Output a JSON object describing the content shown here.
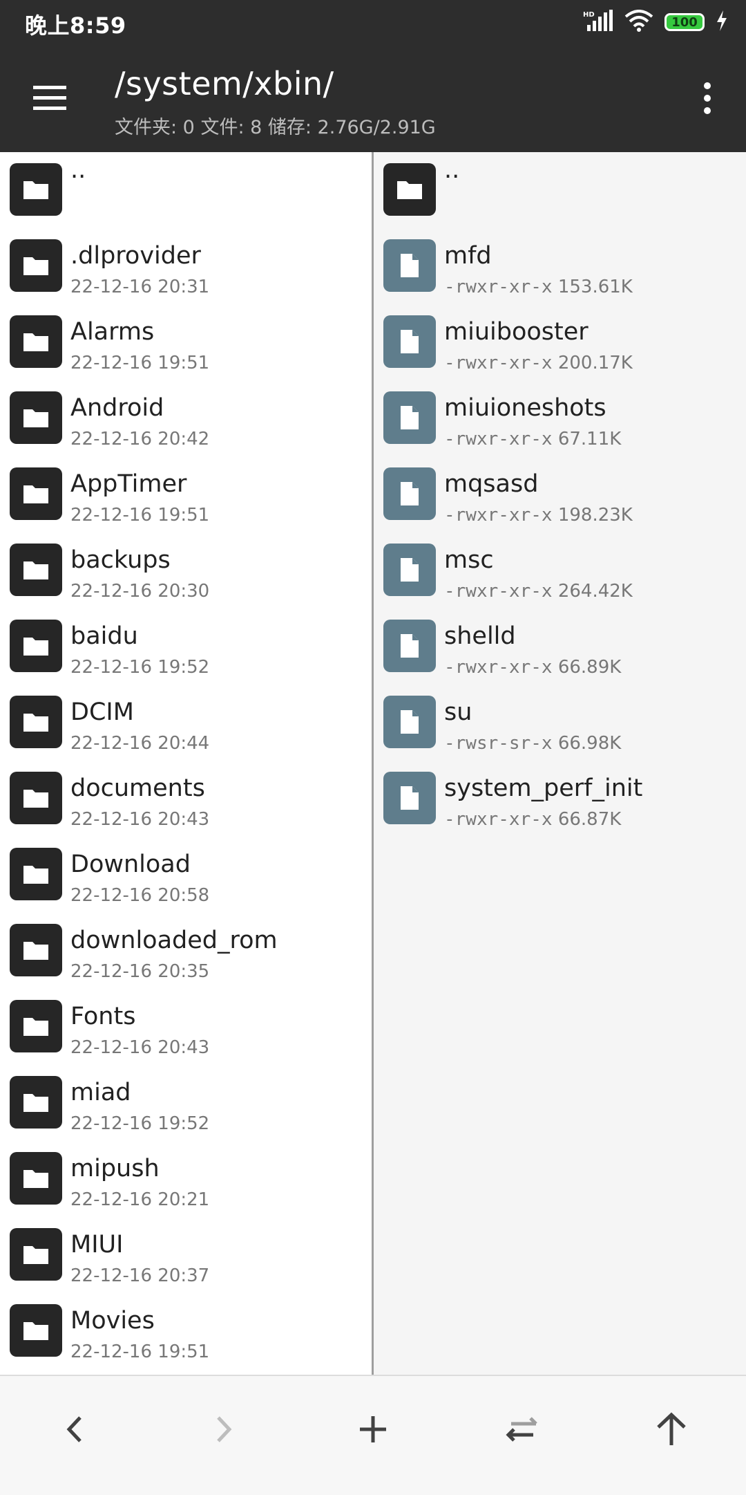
{
  "status": {
    "time": "晚上8:59",
    "network": "HD",
    "battery": "100"
  },
  "header": {
    "path": "/system/xbin/",
    "summary": "文件夹: 0  文件: 8  储存: 2.76G/2.91G"
  },
  "left_pane": {
    "items": [
      {
        "name": "..",
        "meta": ""
      },
      {
        "name": ".dlprovider",
        "meta": "22-12-16 20:31"
      },
      {
        "name": "Alarms",
        "meta": "22-12-16 19:51"
      },
      {
        "name": "Android",
        "meta": "22-12-16 20:42"
      },
      {
        "name": "AppTimer",
        "meta": "22-12-16 19:51"
      },
      {
        "name": "backups",
        "meta": "22-12-16 20:30"
      },
      {
        "name": "baidu",
        "meta": "22-12-16 19:52"
      },
      {
        "name": "DCIM",
        "meta": "22-12-16 20:44"
      },
      {
        "name": "documents",
        "meta": "22-12-16 20:43"
      },
      {
        "name": "Download",
        "meta": "22-12-16 20:58"
      },
      {
        "name": "downloaded_rom",
        "meta": "22-12-16 20:35"
      },
      {
        "name": "Fonts",
        "meta": "22-12-16 20:43"
      },
      {
        "name": "miad",
        "meta": "22-12-16 19:52"
      },
      {
        "name": "mipush",
        "meta": "22-12-16 20:21"
      },
      {
        "name": "MIUI",
        "meta": "22-12-16 20:37"
      },
      {
        "name": "Movies",
        "meta": "22-12-16 19:51"
      }
    ]
  },
  "right_pane": {
    "items": [
      {
        "name": "..",
        "perm": "",
        "size": ""
      },
      {
        "name": "mfd",
        "perm": "-rwxr-xr-x",
        "size": "153.61K"
      },
      {
        "name": "miuibooster",
        "perm": "-rwxr-xr-x",
        "size": "200.17K"
      },
      {
        "name": "miuioneshots",
        "perm": "-rwxr-xr-x",
        "size": "67.11K"
      },
      {
        "name": "mqsasd",
        "perm": "-rwxr-xr-x",
        "size": "198.23K"
      },
      {
        "name": "msc",
        "perm": "-rwxr-xr-x",
        "size": "264.42K"
      },
      {
        "name": "shelld",
        "perm": "-rwxr-xr-x",
        "size": "66.89K"
      },
      {
        "name": "su",
        "perm": "-rwsr-sr-x",
        "size": "66.98K"
      },
      {
        "name": "system_perf_init",
        "perm": "-rwxr-xr-x",
        "size": "66.87K"
      }
    ]
  },
  "bottom_nav": [
    {
      "icon": "chevron-left-icon"
    },
    {
      "icon": "chevron-right-icon"
    },
    {
      "icon": "plus-icon"
    },
    {
      "icon": "swap-icon"
    },
    {
      "icon": "arrow-up-icon"
    }
  ]
}
